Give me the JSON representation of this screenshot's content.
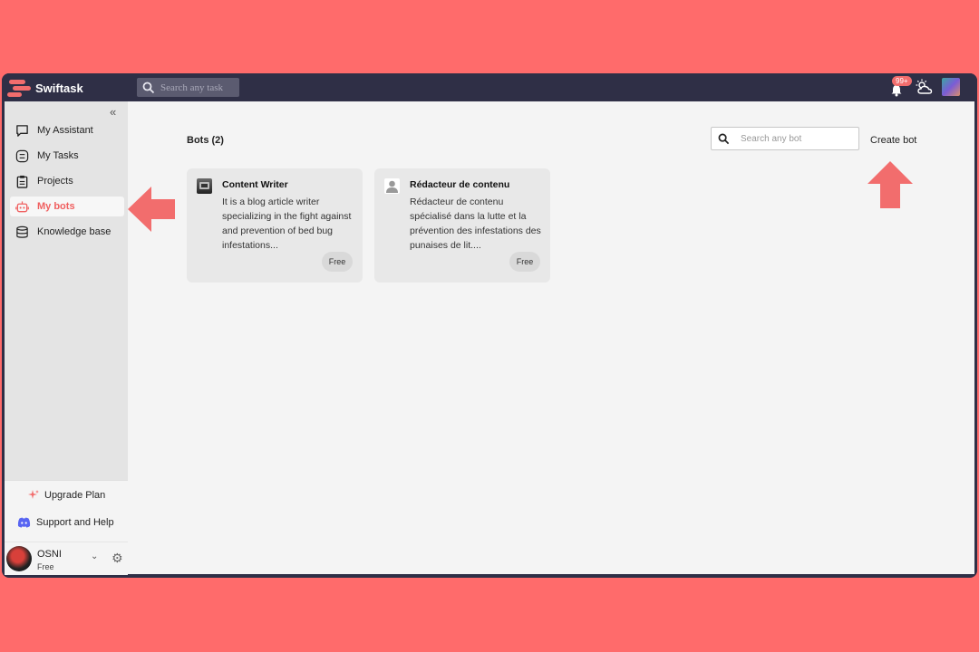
{
  "app": {
    "name": "Swiftask"
  },
  "topbar": {
    "search_placeholder": "Search any task",
    "notification_badge": "99+",
    "icons": [
      "search-icon",
      "bell-icon",
      "weather-icon",
      "avatar"
    ]
  },
  "sidebar": {
    "items": [
      {
        "label": "My Assistant",
        "icon": "chat-icon"
      },
      {
        "label": "My Tasks",
        "icon": "tasks-icon"
      },
      {
        "label": "Projects",
        "icon": "clipboard-icon"
      },
      {
        "label": "My bots",
        "icon": "robot-icon",
        "active": true
      },
      {
        "label": "Knowledge base",
        "icon": "database-icon"
      }
    ],
    "upgrade_label": "Upgrade Plan",
    "support_label": "Support and Help",
    "user": {
      "name": "OSNI",
      "plan": "Free"
    }
  },
  "main": {
    "title": "Bots (2)",
    "search_placeholder": "Search any bot",
    "create_label": "Create bot",
    "bots": [
      {
        "name": "Content Writer",
        "description": "It is a blog article writer specializing in the fight against and prevention of bed bug infestations...",
        "price": "Free"
      },
      {
        "name": "Rédacteur de contenu",
        "description": "Rédacteur de contenu spécialisé dans la lutte et la prévention des infestations des punaises de lit....",
        "price": "Free"
      }
    ]
  },
  "colors": {
    "accent": "#f26d6d",
    "background": "#ff6b6b",
    "topbar": "#2f2f46"
  }
}
